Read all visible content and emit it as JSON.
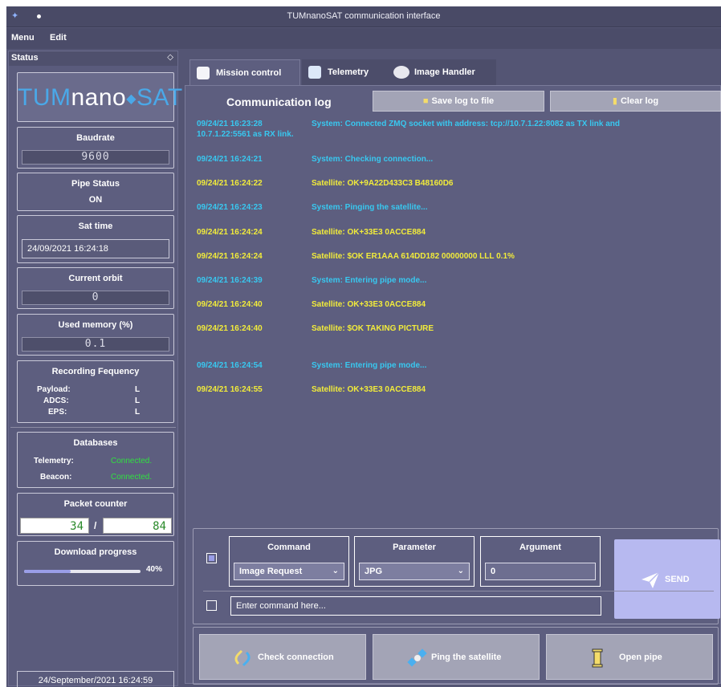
{
  "window": {
    "title": "TUMnanoSAT communication interface",
    "icon": "app-icon"
  },
  "menu": {
    "items": [
      "Menu",
      "Edit"
    ]
  },
  "status": {
    "header": "Status",
    "logo": {
      "part1": "TUM",
      "part2": "nano",
      "part3": "SAT"
    },
    "baudrate": {
      "label": "Baudrate",
      "value": "9600"
    },
    "pipe": {
      "label": "Pipe Status",
      "value": "ON"
    },
    "sat_time": {
      "label": "Sat time",
      "value": "24/09/2021   16:24:18"
    },
    "orbit": {
      "label": "Current orbit",
      "value": "0"
    },
    "memory": {
      "label": "Used memory (%)",
      "value": "0.1"
    },
    "recording": {
      "label": "Recording Fequency",
      "rows": [
        {
          "name": "Payload:",
          "value": "L"
        },
        {
          "name": "ADCS:",
          "value": "L"
        },
        {
          "name": "EPS:",
          "value": "L"
        }
      ]
    },
    "databases": {
      "label": "Databases",
      "rows": [
        {
          "name": "Telemetry:",
          "value": "Connected."
        },
        {
          "name": "Beacon:",
          "value": "Connected."
        }
      ]
    },
    "packets": {
      "label": "Packet counter",
      "a": "34",
      "sep": "/",
      "b": "84"
    },
    "download": {
      "label": "Download progress",
      "percent": 40,
      "percent_label": "40%"
    },
    "footer_time": "24/September/2021    16:24:59"
  },
  "tabs": [
    {
      "label": "Mission control",
      "icon": "satellite-icon",
      "active": true
    },
    {
      "label": "Telemetry",
      "icon": "telemetry-icon",
      "active": false
    },
    {
      "label": "Image Handler",
      "icon": "image-icon",
      "active": false
    }
  ],
  "log": {
    "title": "Communication log",
    "save_label": "Save log to file",
    "clear_label": "Clear log",
    "entries": [
      {
        "ts": "09/24/21  16:23:28",
        "msg": "System: Connected ZMQ socket with address: tcp://10.7.1.22:8082 as TX link and",
        "msg2": "10.7.1.22:5561 as RX link.",
        "kind": "sys"
      },
      {
        "ts": "09/24/21  16:24:21",
        "msg": "System: Checking connection...",
        "kind": "sys"
      },
      {
        "ts": "09/24/21  16:24:22",
        "msg": "Satellite: OK+9A22D433C3 B48160D6",
        "kind": "sat"
      },
      {
        "ts": "09/24/21  16:24:23",
        "msg": "System: Pinging the satellite...",
        "kind": "sys"
      },
      {
        "ts": "09/24/21  16:24:24",
        "msg": "Satellite: OK+33E3 0ACCE884",
        "kind": "sat"
      },
      {
        "ts": "09/24/21  16:24:24",
        "msg": "Satellite: $OK ER1AAA 614DD182 00000000 LLL 0.1%",
        "kind": "sat"
      },
      {
        "ts": "09/24/21  16:24:39",
        "msg": "System: Entering pipe mode...",
        "kind": "sys"
      },
      {
        "ts": "09/24/21  16:24:40",
        "msg": "Satellite: OK+33E3 0ACCE884",
        "kind": "sat"
      },
      {
        "ts": "09/24/21  16:24:40",
        "msg": "Satellite: $OK TAKING PICTURE",
        "kind": "sat"
      },
      {
        "ts": "09/24/21  16:24:54",
        "msg": "System: Entering pipe mode...",
        "kind": "sys"
      },
      {
        "ts": "09/24/21  16:24:55",
        "msg": "Satellite: OK+33E3 0ACCE884",
        "kind": "sat"
      }
    ]
  },
  "command": {
    "command_label": "Command",
    "command_value": "Image Request",
    "parameter_label": "Parameter",
    "parameter_value": "JPG",
    "argument_label": "Argument",
    "argument_value": "0",
    "send_label": "SEND",
    "input_value": "Enter command here..."
  },
  "actions": {
    "check": "Check connection",
    "ping": "Ping the satellite",
    "pipe": "Open pipe"
  },
  "colors": {
    "system_text": "#38c8f0",
    "satellite_text": "#f2ec3a",
    "status_on": "#30e040"
  }
}
